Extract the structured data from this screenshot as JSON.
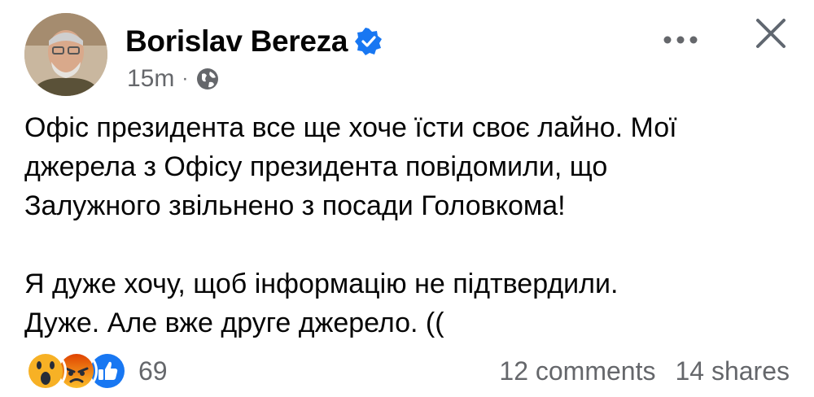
{
  "post": {
    "author": "Borislav Bereza",
    "time": "15m",
    "separator": "·",
    "body": [
      "Офіс президента все ще хоче їсти своє лайно. Мої",
      "джерела з Офісу президента повідомили, що",
      "Залужного звільнено з посади Головкома!",
      "",
      "Я дуже хочу, щоб інформацію не підтвердили.",
      "Дуже. Але вже друге джерело. (("
    ]
  },
  "reactions": {
    "icons": [
      "wow-icon",
      "angry-icon",
      "like-icon"
    ],
    "count": "69"
  },
  "stats": {
    "comments": "12 comments",
    "shares": "14 shares"
  },
  "colors": {
    "text": "#050505",
    "secondary": "#65676b",
    "verified": "#1877f2",
    "like": "#1877f2",
    "wow": "#f7b125",
    "angry": "#e9710f"
  }
}
